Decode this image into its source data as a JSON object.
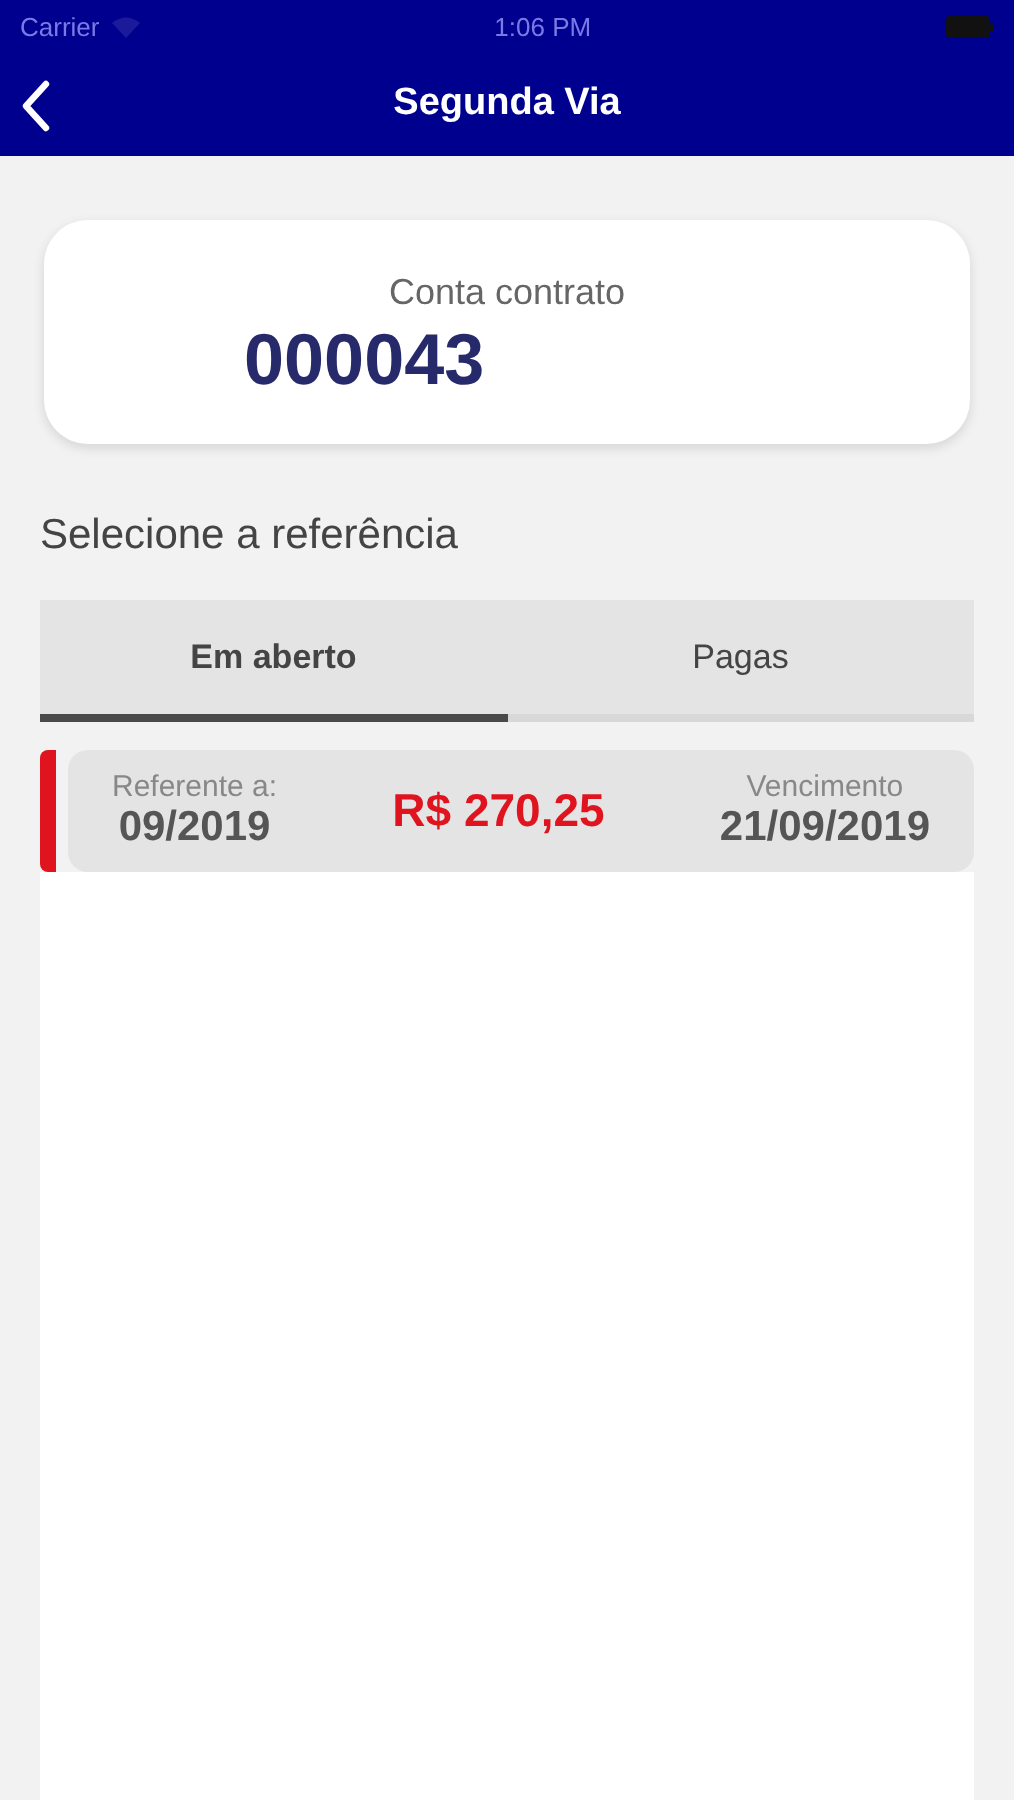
{
  "status_bar": {
    "carrier": "Carrier",
    "time": "1:06 PM"
  },
  "nav_bar": {
    "title": "Segunda Via"
  },
  "account_card": {
    "label": "Conta contrato",
    "number": "000043"
  },
  "section_title": "Selecione a referência",
  "tabs": [
    {
      "label": "Em aberto",
      "selected": true
    },
    {
      "label": "Pagas",
      "selected": false
    }
  ],
  "bills": [
    {
      "reference_label": "Referente a:",
      "reference": "09/2019",
      "amount": "R$ 270,25",
      "due_label": "Vencimento",
      "due_date": "21/09/2019",
      "color": "#e0141e"
    }
  ]
}
